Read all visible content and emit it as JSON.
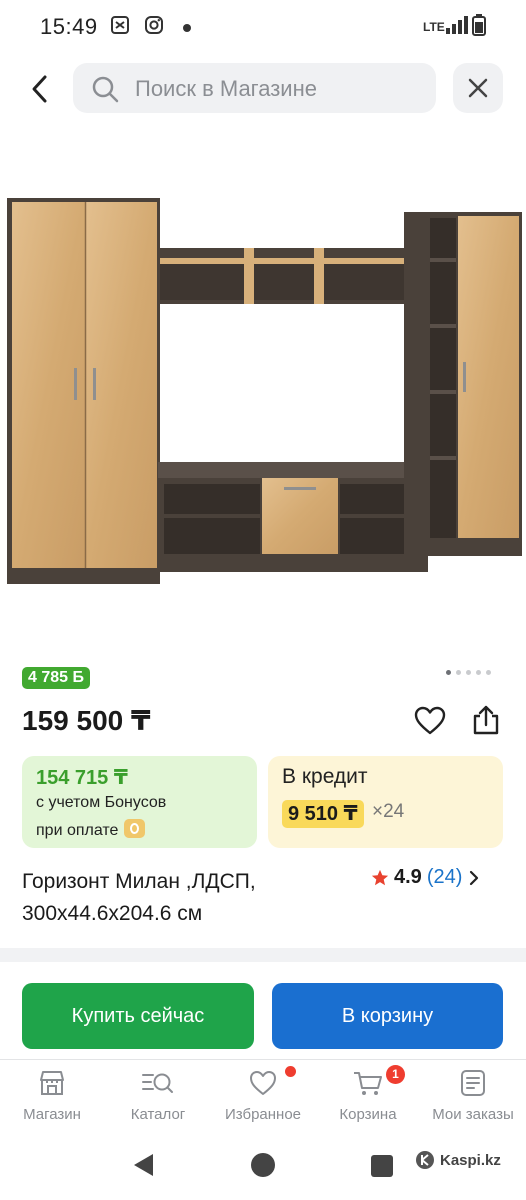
{
  "status_bar": {
    "time": "15:49",
    "network": "LTE"
  },
  "search": {
    "placeholder": "Поиск в Магазине"
  },
  "product": {
    "bonus_badge": "4 785 Б",
    "price": "159 500 ₸",
    "title": "Горизонт Милан ,ЛДСП, 300x44.6x204.6 см",
    "rating": "4.9",
    "reviews": "(24)",
    "image_count": 5,
    "active_image_index": 0
  },
  "offers": {
    "bonus_price": "154 715 ₸",
    "bonus_line1": "с учетом Бонусов",
    "bonus_line2": "при оплате",
    "credit_title": "В кредит",
    "credit_monthly": "9 510 ₸",
    "credit_months": "×24"
  },
  "actions": {
    "buy_now": "Купить сейчас",
    "add_to_cart": "В корзину"
  },
  "bottom_nav": {
    "shop": "Магазин",
    "catalog": "Каталог",
    "favorites": "Избранное",
    "cart": "Корзина",
    "orders": "Мои заказы",
    "cart_count": "1"
  },
  "watermark": "Kaspi.kz",
  "colors": {
    "green": "#1fa44a",
    "blue": "#1a6fd0",
    "bonus_green": "#41a930",
    "credit_yellow": "#f9d95a",
    "badge_red": "#ef3d2f"
  }
}
